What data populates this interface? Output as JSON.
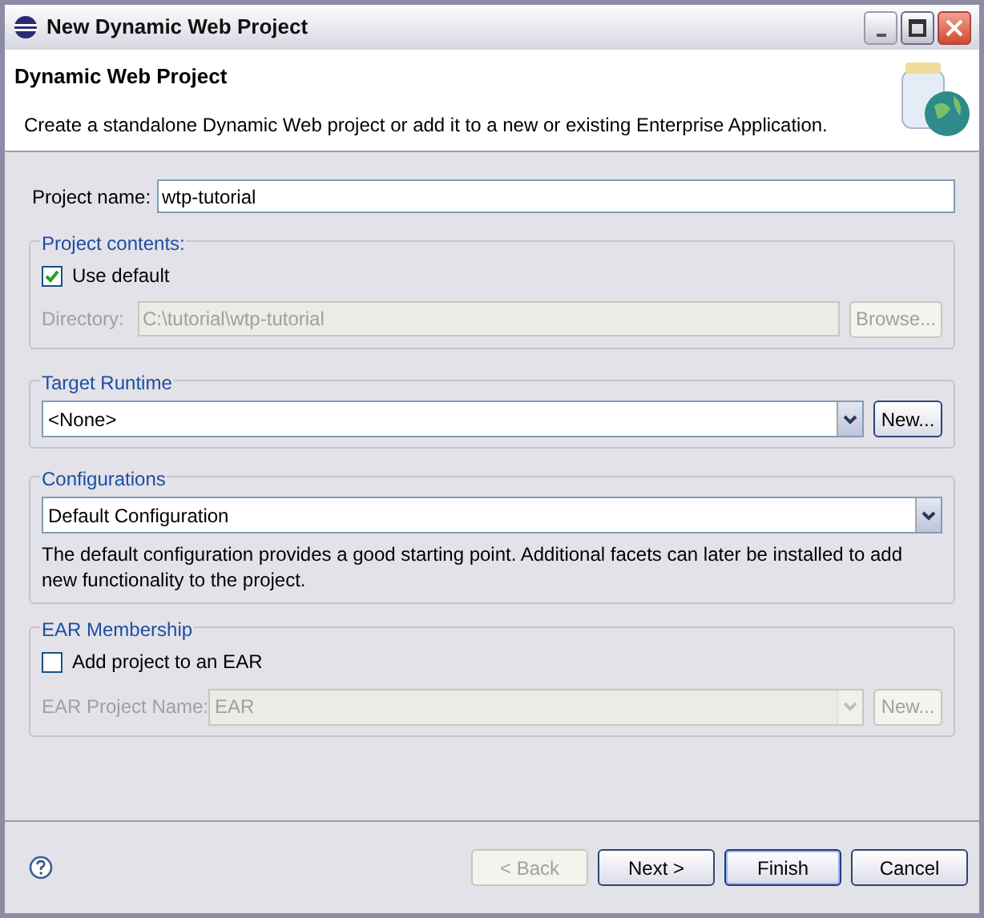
{
  "window": {
    "title": "New Dynamic Web Project"
  },
  "header": {
    "title": "Dynamic Web Project",
    "description": "Create a standalone Dynamic Web project or add it to a new or existing Enterprise Application."
  },
  "project_name": {
    "label": "Project name:",
    "value": "wtp-tutorial"
  },
  "project_contents": {
    "title": "Project contents:",
    "use_default": {
      "label": "Use default",
      "checked": true
    },
    "directory": {
      "label": "Directory:",
      "value": "C:\\tutorial\\wtp-tutorial",
      "disabled": true
    },
    "browse": {
      "label": "Browse...",
      "disabled": true
    }
  },
  "target_runtime": {
    "title": "Target Runtime",
    "value": "<None>",
    "new_button": {
      "label": "New...",
      "disabled": false
    }
  },
  "configurations": {
    "title": "Configurations",
    "value": "Default Configuration",
    "description": "The default configuration provides a good starting point. Additional facets can later be installed to add new functionality to the project."
  },
  "ear_membership": {
    "title": "EAR Membership",
    "add_to_ear": {
      "label": "Add project to an EAR",
      "checked": false
    },
    "ear_project_name": {
      "label": "EAR Project Name:",
      "value": "EAR",
      "disabled": true
    },
    "new_button": {
      "label": "New...",
      "disabled": true
    }
  },
  "buttons": [
    {
      "label": "< Back",
      "disabled": true,
      "default": false
    },
    {
      "label": "Next >",
      "disabled": false,
      "default": false
    },
    {
      "label": "Finish",
      "disabled": false,
      "default": true
    },
    {
      "label": "Cancel",
      "disabled": false,
      "default": false
    }
  ]
}
